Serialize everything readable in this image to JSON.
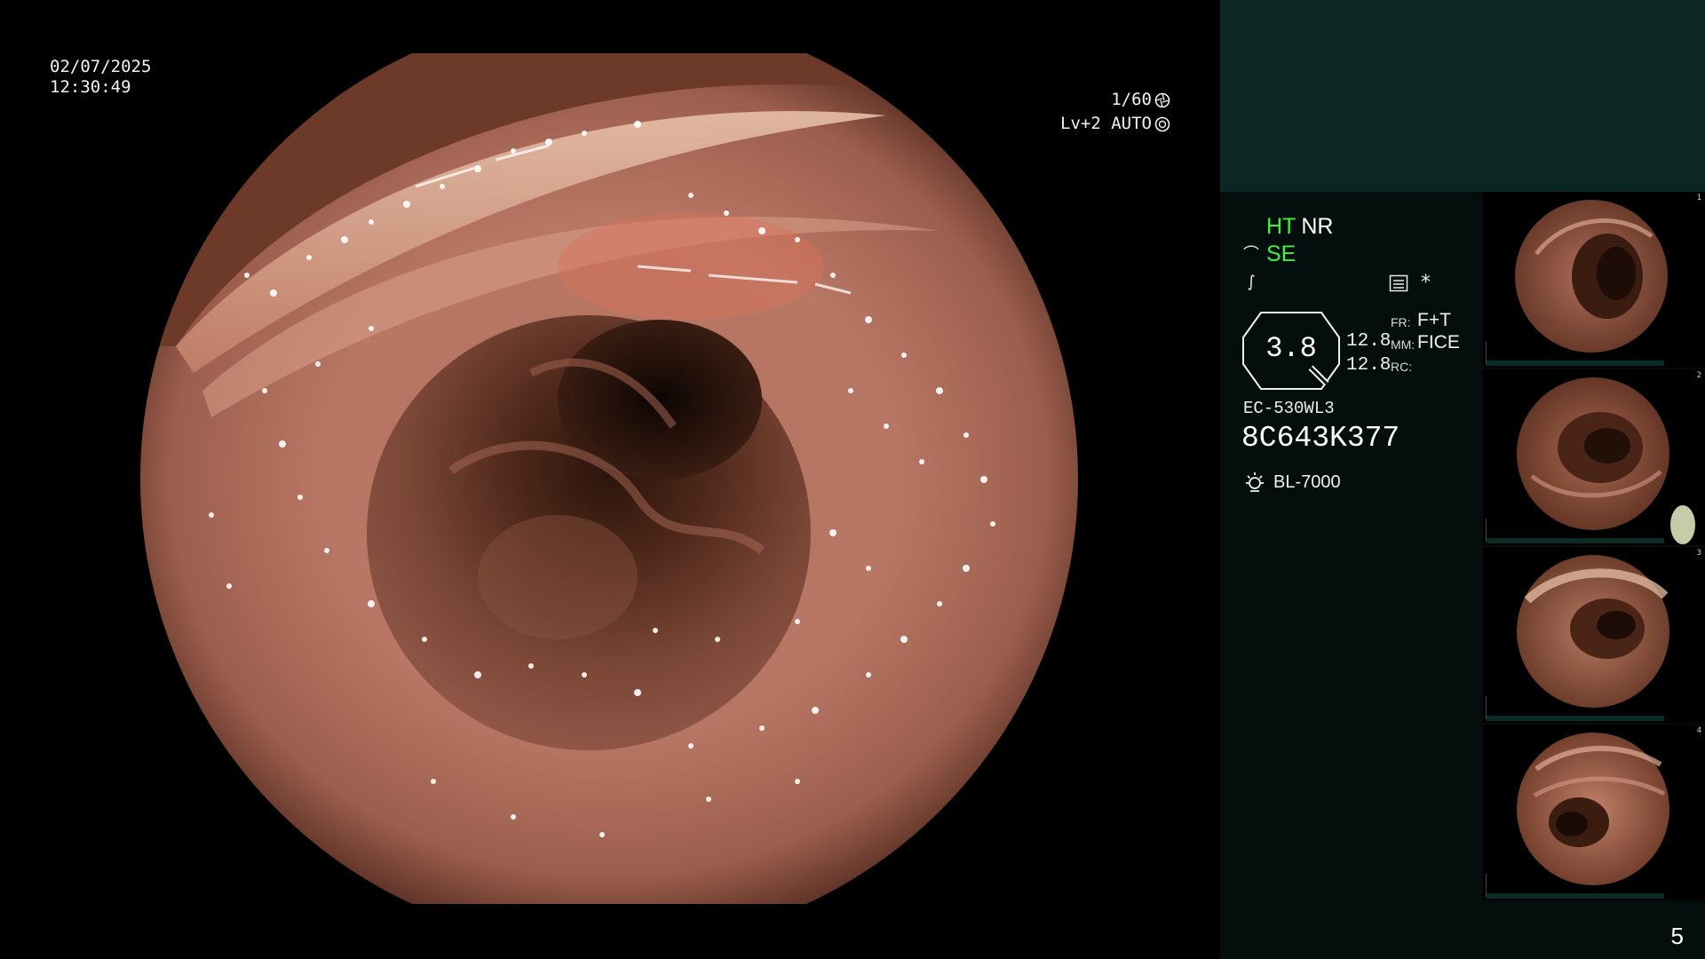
{
  "display": {
    "date": "02/07/2025",
    "time": "12:30:49",
    "shutter": "1/60",
    "iris": "Lv+2 AUTO",
    "shutter_icon": "aperture-icon",
    "iris_icon": "iris-icon"
  },
  "status": {
    "ht_label": "HT",
    "nr_label": "NR",
    "se_label": "SE",
    "se_icon": "scope-tip-icon",
    "curve_icon": "enhance-curve-icon",
    "record_icon": "record-list-icon",
    "star_glyph": "*"
  },
  "zoom": {
    "value": "3.8",
    "meas1": "12.8",
    "meas2": "12.8",
    "label_fr": "FR:",
    "label_mm": "MM:",
    "label_rc": "RC:",
    "value_fr": "F+T",
    "value_mm": "FICE",
    "value_rc": ""
  },
  "scope": {
    "model": "EC-530WL3",
    "serial": "8C643K377",
    "light_source": "BL-7000",
    "light_icon": "light-source-icon"
  },
  "thumbnails": [
    {
      "index": "1"
    },
    {
      "index": "2"
    },
    {
      "index": "3"
    },
    {
      "index": "4"
    }
  ],
  "page_number": "5",
  "colors": {
    "panel_bg": "#040f0d",
    "panel_header": "#0c2623",
    "status_green": "#3df23d",
    "tissue": "#b27060"
  }
}
